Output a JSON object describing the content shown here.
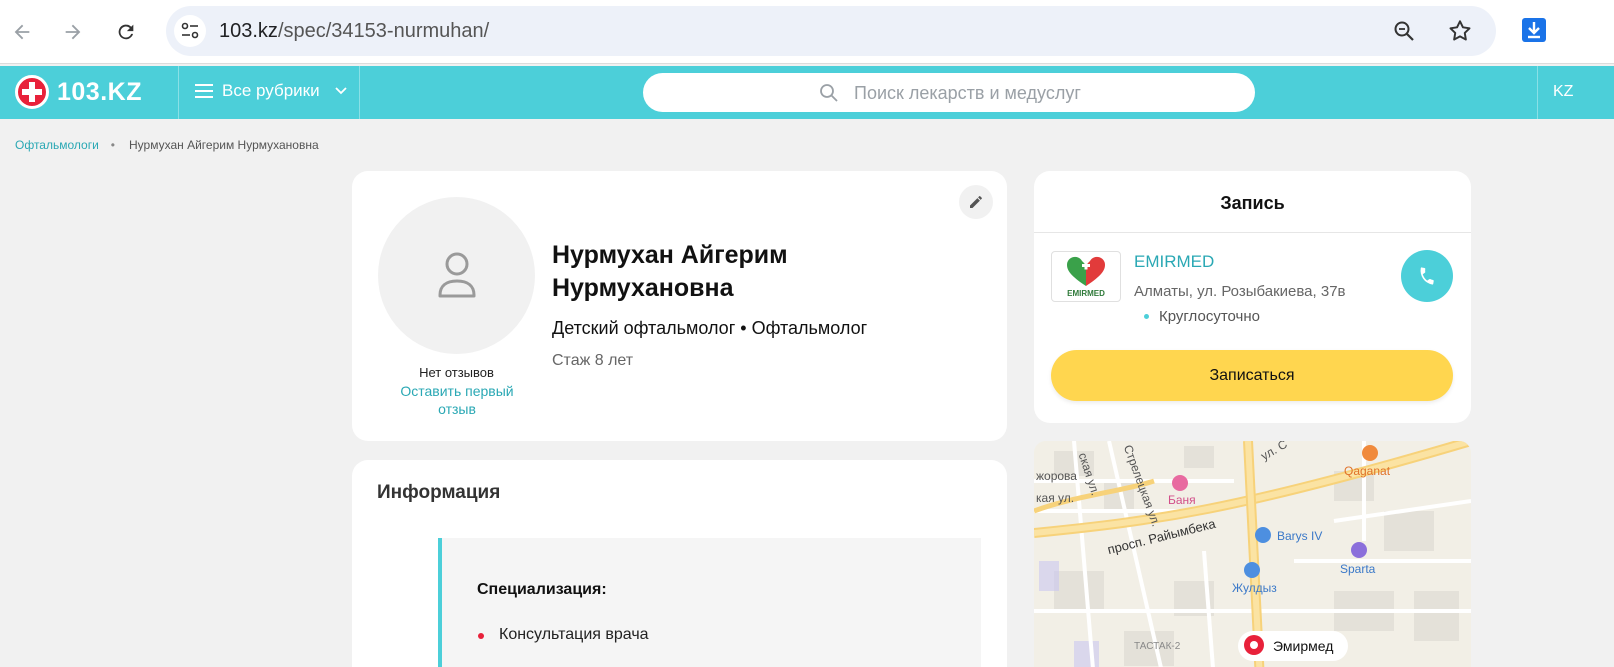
{
  "browser": {
    "url_host": "103.kz",
    "url_path": "/spec/34153-nurmuhan/"
  },
  "header": {
    "logo_text": "103.KZ",
    "rubrics_label": "Все рубрики",
    "search_placeholder": "Поиск лекарств и медуслуг",
    "lang_label": "KZ",
    "accent_color": "#4ccfd9"
  },
  "breadcrumb": {
    "parent": "Офтальмологи",
    "separator": "•",
    "current": "Нурмухан Айгерим Нурмухановна"
  },
  "profile": {
    "name": "Нурмухан Айгерим Нурмухановна",
    "specialties": "Детский офтальмолог • Офтальмолог",
    "experience": "Стаж 8 лет",
    "reviews_none": "Нет отзывов",
    "reviews_link": "Оставить первый отзыв"
  },
  "info": {
    "title": "Информация",
    "specialization_title": "Специализация:",
    "items": [
      "Консультация врача"
    ]
  },
  "booking": {
    "title": "Запись",
    "clinic_logo_text": "EMIRMED",
    "clinic_name": "EMIRMED",
    "clinic_address": "Алматы, ул. Розыбакиева, 37в",
    "clinic_hours": "Круглосуточно",
    "book_button": "Записаться",
    "book_color": "#ffd64f"
  },
  "map": {
    "labels": {
      "street_1": "жорова",
      "street_2": "ская ул.",
      "street_3": "Стрелецкая ул.",
      "street_4": "кая ул.",
      "avenue": "просп. Райымбека",
      "street_5": "ул. С",
      "banya": "Баня",
      "qaganat": "Qaganat",
      "barys": "Barys IV",
      "sparta": "Sparta",
      "zhuldyz": "Жулдыз",
      "tastak": "ТАСТАК-2",
      "emirmed": "Эмирмед"
    }
  }
}
